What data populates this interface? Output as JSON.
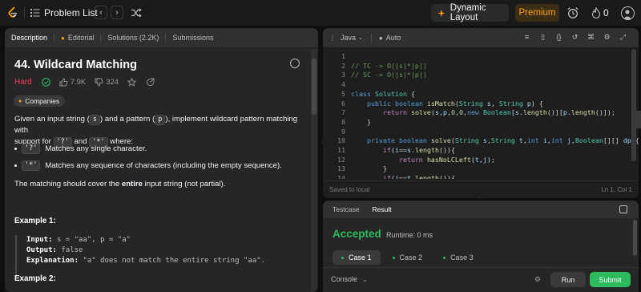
{
  "topbar": {
    "problem_list": "Problem List",
    "prev": "‹",
    "next": "›",
    "dynamic_layout": "Dynamic Layout",
    "premium": "Premium",
    "streak_count": "0"
  },
  "problem": {
    "tabs": [
      {
        "label": "Description",
        "active": true
      },
      {
        "label": "Editorial",
        "locked": true
      },
      {
        "label": "Solutions (2.2K)"
      },
      {
        "label": "Submissions"
      }
    ],
    "title": "44. Wildcard Matching",
    "difficulty": "Hard",
    "likes": "7.9K",
    "dislikes": "324",
    "companies": "Companies",
    "desc_1a": "Given an input string (",
    "desc_1b": ") and a pattern (",
    "desc_1c": "), implement wildcard pattern matching with",
    "chip_s": "s",
    "chip_p": "p",
    "desc_2a": "support for ",
    "chip_q": "'?'",
    "desc_2b": " and ",
    "chip_star": "'*'",
    "desc_2c": " where:",
    "bullet1_chip": "'?'",
    "bullet1_text": "Matches any single character.",
    "bullet2_chip": "'*'",
    "bullet2_text": "Matches any sequence of characters (including the empty sequence).",
    "desc_3a": "The matching should cover the ",
    "desc_3b": "entire",
    "desc_3c": " input string (not partial).",
    "example1_title": "Example 1:",
    "ex_input_lbl": "Input:",
    "ex_input_val": "s = \"aa\", p = \"a\"",
    "ex_output_lbl": "Output:",
    "ex_output_val": "false",
    "ex_expl_lbl": "Explanation:",
    "ex_expl_val": "\"a\" does not match the entire string \"aa\".",
    "example2_title": "Example 2:"
  },
  "editor": {
    "language": "Java",
    "mode": "Auto",
    "line_numbers": [
      "1",
      "2",
      "3",
      "4",
      "5",
      "6",
      "7",
      "8",
      "9",
      "10",
      "11",
      "12",
      "13",
      "14"
    ],
    "saved": "Saved to local",
    "cursor": "Ln 1, Col 1"
  },
  "result": {
    "tabs": [
      {
        "label": "Testcase"
      },
      {
        "label": "Result",
        "active": true
      }
    ],
    "status": "Accepted",
    "runtime": "Runtime: 0 ms",
    "cases": [
      {
        "label": "Case 1",
        "active": true
      },
      {
        "label": "Case 2"
      },
      {
        "label": "Case 3"
      }
    ]
  },
  "bottom": {
    "console": "Console",
    "run": "Run",
    "submit": "Submit"
  },
  "colors": {
    "accent": "#ffa116",
    "hard": "#ff375f",
    "accepted": "#2cbb5d"
  }
}
